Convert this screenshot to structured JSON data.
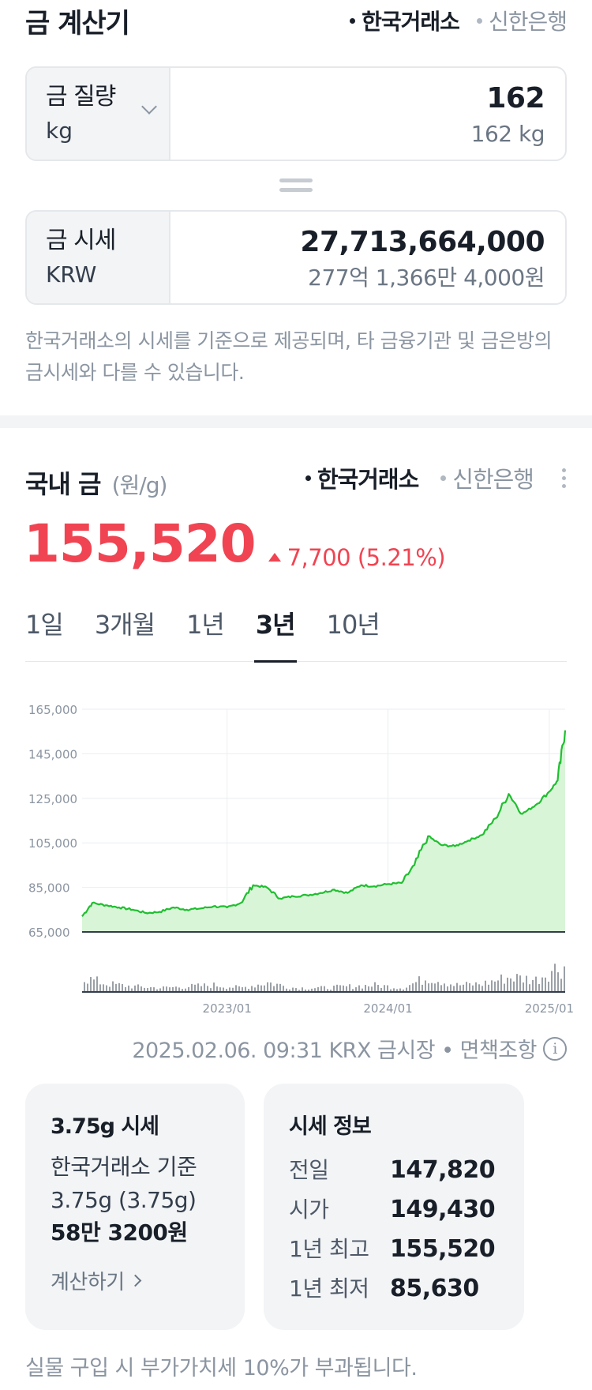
{
  "calculator": {
    "title": "금 계산기",
    "sources": [
      {
        "label": "한국거래소",
        "active": true
      },
      {
        "label": "신한은행",
        "active": false
      }
    ],
    "weight": {
      "label": "금 질량",
      "unit": "kg",
      "value": "162",
      "value_sub": "162 kg"
    },
    "price": {
      "label": "금 시세",
      "unit": "KRW",
      "value": "27,713,664,000",
      "value_sub": "277억 1,366만 4,000원"
    },
    "notice": "한국거래소의 시세를 기준으로 제공되며, 타 금융기관 및 금은방의 금시세와 다를 수 있습니다."
  },
  "domestic": {
    "title": "국내 금",
    "unit": "(원/g)",
    "sources": [
      {
        "label": "한국거래소",
        "active": true
      },
      {
        "label": "신한은행",
        "active": false
      }
    ],
    "price": "155,520",
    "change": "7,700 (5.21%)",
    "tabs": [
      {
        "label": "1일",
        "active": false
      },
      {
        "label": "3개월",
        "active": false
      },
      {
        "label": "1년",
        "active": false
      },
      {
        "label": "3년",
        "active": true
      },
      {
        "label": "10년",
        "active": false
      }
    ],
    "timestamp": "2025.02.06. 09:31 KRX 금시장 • 면책조항"
  },
  "chart_data": {
    "type": "area",
    "title": "",
    "xlabel": "",
    "ylabel": "",
    "y_ticks": [
      "165,000",
      "145,000",
      "125,000",
      "105,000",
      "85,000",
      "65,000"
    ],
    "x_ticks": [
      "2023/01",
      "2024/01",
      "2025/01"
    ],
    "ylim": [
      65000,
      165000
    ],
    "xlim": [
      "2022-02-06",
      "2025-02-06"
    ],
    "grid": true,
    "colors": {
      "line": "#1fbf2f",
      "fill": "#d9f5d8",
      "volume": "#9aa0a6"
    },
    "series": [
      {
        "x": [
          "2022-02-06",
          "2022-03-01",
          "2022-04-01",
          "2022-05-01",
          "2022-06-01",
          "2022-07-01",
          "2022-08-01",
          "2022-09-01",
          "2022-10-01",
          "2022-11-01",
          "2022-12-01",
          "2023-01-01",
          "2023-02-01",
          "2023-03-01",
          "2023-04-01",
          "2023-05-01",
          "2023-06-01",
          "2023-07-01",
          "2023-08-01",
          "2023-09-01",
          "2023-10-01",
          "2023-11-01",
          "2023-12-01",
          "2024-01-01",
          "2024-02-01",
          "2024-03-01",
          "2024-04-01",
          "2024-05-01",
          "2024-06-01",
          "2024-07-01",
          "2024-08-01",
          "2024-09-01",
          "2024-10-01",
          "2024-11-01",
          "2024-12-01",
          "2025-01-01",
          "2025-01-20",
          "2025-02-06"
        ],
        "y": [
          72000,
          78000,
          77000,
          76000,
          75000,
          73500,
          74000,
          76000,
          75000,
          75500,
          76500,
          76000,
          78000,
          86000,
          85000,
          80000,
          81000,
          81500,
          82500,
          84000,
          82500,
          86000,
          85500,
          86500,
          87000,
          95000,
          108000,
          104000,
          103500,
          106000,
          108500,
          116000,
          127000,
          118000,
          122000,
          128000,
          133000,
          155520
        ]
      }
    ],
    "volume_series": [
      {
        "x": [
          "2022-02",
          "2022-04",
          "2022-06",
          "2022-08",
          "2022-10",
          "2022-12",
          "2023-02",
          "2023-04",
          "2023-06",
          "2023-08",
          "2023-10",
          "2023-12",
          "2024-02",
          "2024-04",
          "2024-06",
          "2024-08",
          "2024-10",
          "2024-12",
          "2025-01",
          "2025-02"
        ],
        "y": [
          0.55,
          0.3,
          0.2,
          0.15,
          0.2,
          0.25,
          0.15,
          0.35,
          0.15,
          0.15,
          0.2,
          0.25,
          0.15,
          0.55,
          0.25,
          0.3,
          0.55,
          0.45,
          0.8,
          0.95
        ]
      }
    ]
  },
  "cards": {
    "gram": {
      "title": "3.75g 시세",
      "line1": "한국거래소 기준",
      "line2": "3.75g (3.75g)",
      "amount": "58만 3200원",
      "link": "계산하기"
    },
    "info": {
      "title": "시세 정보",
      "rows": [
        {
          "label": "전일",
          "value": "147,820"
        },
        {
          "label": "시가",
          "value": "149,430"
        },
        {
          "label": "1년 최고",
          "value": "155,520"
        },
        {
          "label": "1년 최저",
          "value": "85,630"
        }
      ]
    }
  },
  "footer_note": "실물 구입 시 부가가치세 10%가 부과됩니다."
}
